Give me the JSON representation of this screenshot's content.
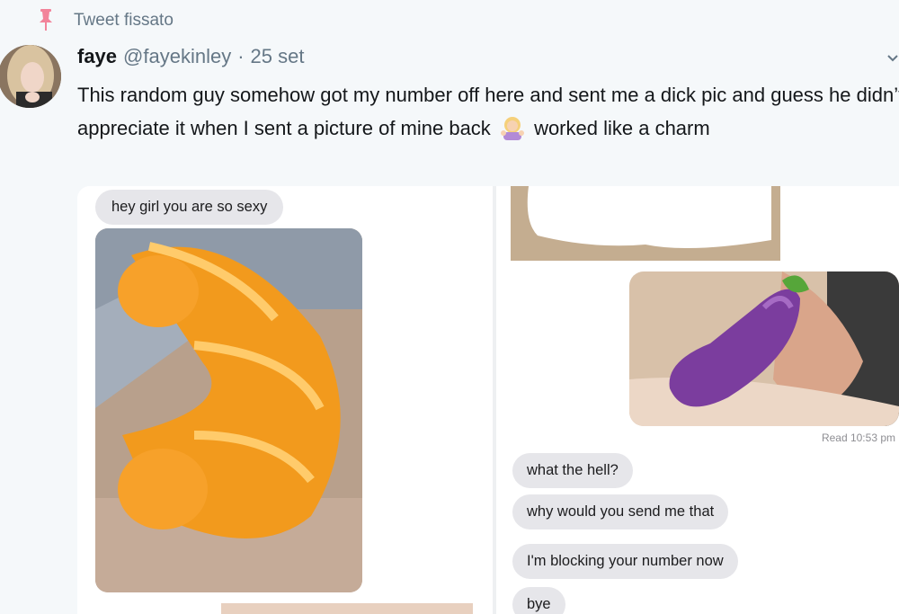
{
  "pinned": {
    "label": "Tweet fissato",
    "icon": "pin-icon"
  },
  "tweet": {
    "name": "faye",
    "handle": "@fayekinley",
    "separator": "·",
    "date": "25 set",
    "text_before": "This random guy somehow got my number off here and sent me a dick pic and guess he didn’t appreciate it when I sent a picture of mine back",
    "emoji": "woman-shrugging-emoji",
    "text_after": "worked like a charm",
    "menu_icon": "chevron-down-icon"
  },
  "media": {
    "left": {
      "message": "hey girl you are so sexy",
      "image": "croissant-covered-photo"
    },
    "right": {
      "image_top": "cropped-photo",
      "image_main": "eggplant-covered-photo",
      "read_receipt": "Read 10:53 pm",
      "messages": [
        "what the hell?",
        "why would you send me that",
        "I'm blocking your number now",
        "bye"
      ]
    }
  },
  "colors": {
    "background": "#f5f8fa",
    "text": "#14171a",
    "muted": "#657786",
    "pin": "#e0245e",
    "bubble": "#e6e6ea"
  }
}
